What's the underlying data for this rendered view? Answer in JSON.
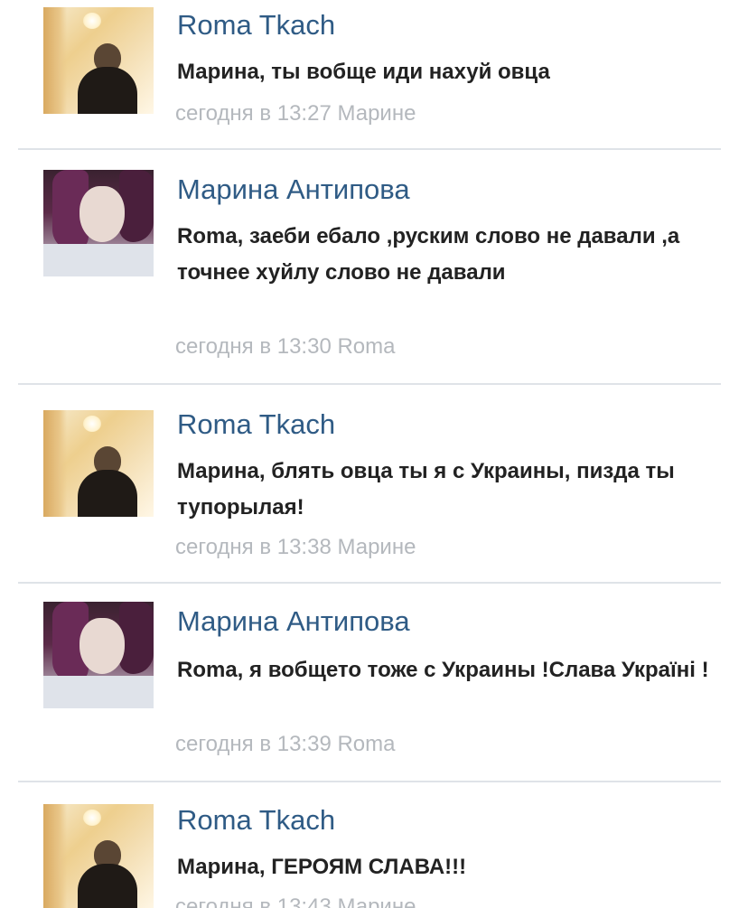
{
  "comments": [
    {
      "author": "Roma Tkach",
      "text": "Марина, ты вобще иди нахуй овца",
      "meta": "сегодня в 13:27 Марине",
      "avatar": "roma-avatar"
    },
    {
      "author": "Марина Антипова",
      "text": "Roma, заеби ебало ,руским слово не давали ,а точнее хуйлу слово не давали",
      "meta": "сегодня в 13:30 Roma",
      "avatar": "marina-avatar"
    },
    {
      "author": "Roma Tkach",
      "text": "Марина, блять овца ты я с Украины, пизда ты тупорылая!",
      "meta": "сегодня в 13:38 Марине",
      "avatar": "roma-avatar"
    },
    {
      "author": "Марина Антипова",
      "text": "Roma, я вобщето тоже с Украины !Слава Україні !",
      "meta": "сегодня в 13:39 Roma",
      "avatar": "marina-avatar"
    },
    {
      "author": "Roma Tkach",
      "text": "Марина, ГЕРОЯМ СЛАВА!!!",
      "meta": "сегодня в 13:43 Марине",
      "avatar": "roma-avatar"
    }
  ],
  "colors": {
    "author_name": "#2f5b85",
    "message_text": "#222222",
    "meta_text": "#b4b8bd",
    "divider": "#dfe3e8"
  }
}
